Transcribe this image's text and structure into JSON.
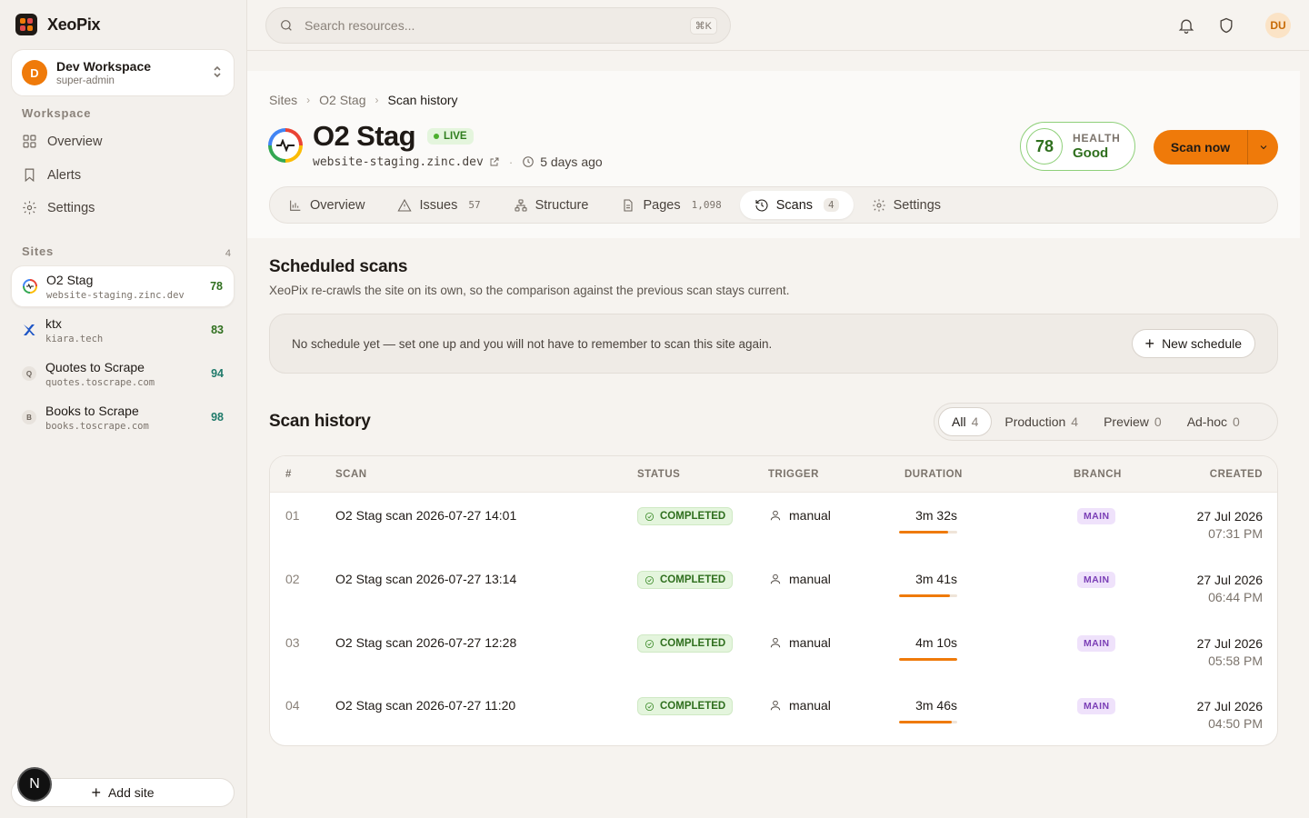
{
  "app": {
    "name": "XeoPix",
    "logo_colors": [
      "#ef7a0a",
      "#e24a4a",
      "#e24a4a",
      "#ef7a0a"
    ]
  },
  "workspace": {
    "initial": "D",
    "name": "Dev Workspace",
    "role": "super-admin"
  },
  "sidebar": {
    "workspace_label": "Workspace",
    "nav": [
      {
        "label": "Overview",
        "icon": "grid-icon"
      },
      {
        "label": "Alerts",
        "icon": "bookmark-icon"
      },
      {
        "label": "Settings",
        "icon": "gear-icon"
      }
    ],
    "sites_label": "Sites",
    "sites_count": "4",
    "sites": [
      {
        "name": "O2 Stag",
        "url": "website-staging.zinc.dev",
        "score": "78",
        "icon": "pulse-logo",
        "score_color": "#2f6f1e"
      },
      {
        "name": "ktx",
        "url": "kiara.tech",
        "score": "83",
        "icon": "x-logo",
        "score_color": "#2f6f1e"
      },
      {
        "name": "Quotes to Scrape",
        "url": "quotes.toscrape.com",
        "score": "94",
        "icon": "Q",
        "score_color": "#1f7a6a"
      },
      {
        "name": "Books to Scrape",
        "url": "books.toscrape.com",
        "score": "98",
        "icon": "B",
        "score_color": "#1f7a6a"
      }
    ],
    "add_site_label": "Add site",
    "n_badge": "N"
  },
  "topbar": {
    "search_placeholder": "Search resources...",
    "search_shortcut": "⌘K",
    "user_initials": "DU"
  },
  "header": {
    "breadcrumbs": [
      "Sites",
      "O2 Stag",
      "Scan history"
    ],
    "title": "O2 Stag",
    "status_badge": "LIVE",
    "url": "website-staging.zinc.dev",
    "last_scan": "5 days ago",
    "health": {
      "score": "78",
      "label": "HEALTH",
      "value": "Good"
    },
    "scan_button": "Scan now",
    "tabs": [
      {
        "label": "Overview",
        "count": "",
        "icon": "bar-chart-icon"
      },
      {
        "label": "Issues",
        "count": "57",
        "icon": "warning-icon"
      },
      {
        "label": "Structure",
        "count": "",
        "icon": "sitemap-icon"
      },
      {
        "label": "Pages",
        "count": "1,098",
        "icon": "document-icon"
      },
      {
        "label": "Scans",
        "count": "4",
        "icon": "history-icon",
        "active": true
      },
      {
        "label": "Settings",
        "count": "",
        "icon": "gear-icon"
      }
    ]
  },
  "scheduled": {
    "title": "Scheduled scans",
    "subtitle": "XeoPix re-crawls the site on its own, so the comparison against the previous scan stays current.",
    "empty_text": "No schedule yet — set one up and you will not have to remember to scan this site again.",
    "new_button": "New schedule"
  },
  "history": {
    "title": "Scan history",
    "filters": [
      {
        "label": "All",
        "count": "4",
        "active": true
      },
      {
        "label": "Production",
        "count": "4"
      },
      {
        "label": "Preview",
        "count": "0"
      },
      {
        "label": "Ad-hoc",
        "count": "0"
      }
    ],
    "columns": [
      "#",
      "SCAN",
      "STATUS",
      "TRIGGER",
      "DURATION",
      "BRANCH",
      "CREATED"
    ],
    "rows": [
      {
        "num": "01",
        "name": "O2 Stag scan 2026-07-27 14:01",
        "status": "COMPLETED",
        "trigger": "manual",
        "duration": "3m 32s",
        "duration_fraction": 0.84,
        "branch": "MAIN",
        "date": "27 Jul 2026",
        "time": "07:31 PM"
      },
      {
        "num": "02",
        "name": "O2 Stag scan 2026-07-27 13:14",
        "status": "COMPLETED",
        "trigger": "manual",
        "duration": "3m 41s",
        "duration_fraction": 0.88,
        "branch": "MAIN",
        "date": "27 Jul 2026",
        "time": "06:44 PM"
      },
      {
        "num": "03",
        "name": "O2 Stag scan 2026-07-27 12:28",
        "status": "COMPLETED",
        "trigger": "manual",
        "duration": "4m 10s",
        "duration_fraction": 1.0,
        "branch": "MAIN",
        "date": "27 Jul 2026",
        "time": "05:58 PM"
      },
      {
        "num": "04",
        "name": "O2 Stag scan 2026-07-27 11:20",
        "status": "COMPLETED",
        "trigger": "manual",
        "duration": "3m 46s",
        "duration_fraction": 0.9,
        "branch": "MAIN",
        "date": "27 Jul 2026",
        "time": "04:50 PM"
      }
    ]
  }
}
